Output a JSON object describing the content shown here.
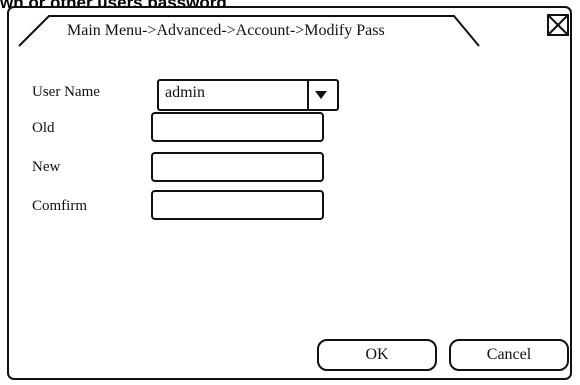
{
  "caption": "wn or other users password",
  "window": {
    "title": "Main Menu->Advanced->Account->Modify Pass"
  },
  "icons": {
    "close": "close-icon",
    "dropdown": "triangle-down-icon"
  },
  "form": {
    "user_name_label": "User Name",
    "user_name_value": "admin",
    "old_label": "Old",
    "old_value": "",
    "new_label": "New",
    "new_value": "",
    "confirm_label": "Comfirm",
    "confirm_value": ""
  },
  "buttons": {
    "ok": "OK",
    "cancel": "Cancel"
  }
}
